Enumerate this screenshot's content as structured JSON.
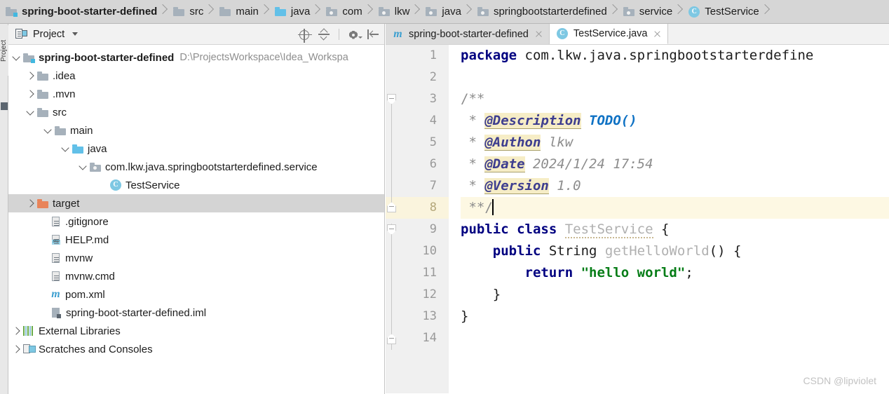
{
  "breadcrumb": {
    "items": [
      {
        "label": "spring-boot-starter-defined",
        "icon": "module-folder-icon",
        "bold": true
      },
      {
        "label": "src",
        "icon": "folder-icon",
        "bold": false
      },
      {
        "label": "main",
        "icon": "folder-icon",
        "bold": false
      },
      {
        "label": "java",
        "icon": "source-folder-icon",
        "bold": false
      },
      {
        "label": "com",
        "icon": "package-icon",
        "bold": false
      },
      {
        "label": "lkw",
        "icon": "package-icon",
        "bold": false
      },
      {
        "label": "java",
        "icon": "package-icon",
        "bold": false
      },
      {
        "label": "springbootstarterdefined",
        "icon": "package-icon",
        "bold": false
      },
      {
        "label": "service",
        "icon": "package-icon",
        "bold": false
      },
      {
        "label": "TestService",
        "icon": "java-class-icon",
        "bold": false
      }
    ]
  },
  "tool_strip": {
    "label": "Project"
  },
  "project_panel": {
    "title": "Project",
    "tools": [
      {
        "name": "locate-in-tree-icon",
        "title": "Select Opened File"
      },
      {
        "name": "collapse-all-icon",
        "title": "Collapse All"
      },
      {
        "name": "settings-gear-icon",
        "title": "Options"
      },
      {
        "name": "hide-panel-icon",
        "title": "Hide"
      }
    ],
    "tree": [
      {
        "label": "spring-boot-starter-defined",
        "path": "D:\\ProjectsWorkspace\\Idea_Workspa",
        "indent": 0,
        "twisty": "down",
        "icon": "module-folder-icon",
        "bold": true,
        "selected": false
      },
      {
        "label": ".idea",
        "path": "",
        "indent": 1,
        "twisty": "right",
        "icon": "folder-icon",
        "bold": false,
        "selected": false
      },
      {
        "label": ".mvn",
        "path": "",
        "indent": 1,
        "twisty": "right",
        "icon": "folder-icon",
        "bold": false,
        "selected": false
      },
      {
        "label": "src",
        "path": "",
        "indent": 1,
        "twisty": "down",
        "icon": "folder-icon",
        "bold": false,
        "selected": false
      },
      {
        "label": "main",
        "path": "",
        "indent": 2,
        "twisty": "down",
        "icon": "folder-icon",
        "bold": false,
        "selected": false
      },
      {
        "label": "java",
        "path": "",
        "indent": 3,
        "twisty": "down",
        "icon": "source-folder-icon",
        "bold": false,
        "selected": false
      },
      {
        "label": "com.lkw.java.springbootstarterdefined.service",
        "path": "",
        "indent": 4,
        "twisty": "down",
        "icon": "package-icon",
        "bold": false,
        "selected": false
      },
      {
        "label": "TestService",
        "path": "",
        "indent": 6,
        "twisty": "none",
        "icon": "java-class-icon",
        "bold": false,
        "selected": false
      },
      {
        "label": "target",
        "path": "",
        "indent": 1,
        "twisty": "right",
        "icon": "excluded-folder-icon",
        "bold": false,
        "selected": true
      },
      {
        "label": ".gitignore",
        "path": "",
        "indent": 2,
        "twisty": "none",
        "icon": "text-file-icon",
        "bold": false,
        "selected": false
      },
      {
        "label": "HELP.md",
        "path": "",
        "indent": 2,
        "twisty": "none",
        "icon": "markdown-file-icon",
        "bold": false,
        "selected": false
      },
      {
        "label": "mvnw",
        "path": "",
        "indent": 2,
        "twisty": "none",
        "icon": "text-file-icon",
        "bold": false,
        "selected": false
      },
      {
        "label": "mvnw.cmd",
        "path": "",
        "indent": 2,
        "twisty": "none",
        "icon": "text-file-icon",
        "bold": false,
        "selected": false
      },
      {
        "label": "pom.xml",
        "path": "",
        "indent": 2,
        "twisty": "none",
        "icon": "maven-file-icon",
        "bold": false,
        "selected": false
      },
      {
        "label": "spring-boot-starter-defined.iml",
        "path": "",
        "indent": 2,
        "twisty": "none",
        "icon": "iml-file-icon",
        "bold": false,
        "selected": false
      },
      {
        "label": "External Libraries",
        "path": "",
        "indent": 0,
        "twisty": "right",
        "icon": "libraries-icon",
        "bold": false,
        "selected": false
      },
      {
        "label": "Scratches and Consoles",
        "path": "",
        "indent": 0,
        "twisty": "right",
        "icon": "scratches-icon",
        "bold": false,
        "selected": false
      }
    ]
  },
  "editor": {
    "tabs": [
      {
        "label": "spring-boot-starter-defined",
        "icon": "maven-file-icon",
        "active": false
      },
      {
        "label": "TestService.java",
        "icon": "java-class-icon",
        "active": true
      }
    ],
    "lines": [
      {
        "no": "1",
        "caret_line": false
      },
      {
        "no": "2",
        "caret_line": false
      },
      {
        "no": "3",
        "caret_line": false
      },
      {
        "no": "4",
        "caret_line": false
      },
      {
        "no": "5",
        "caret_line": false
      },
      {
        "no": "6",
        "caret_line": false
      },
      {
        "no": "7",
        "caret_line": false
      },
      {
        "no": "8",
        "caret_line": true
      },
      {
        "no": "9",
        "caret_line": false
      },
      {
        "no": "10",
        "caret_line": false
      },
      {
        "no": "11",
        "caret_line": false
      },
      {
        "no": "12",
        "caret_line": false
      },
      {
        "no": "13",
        "caret_line": false
      },
      {
        "no": "14",
        "caret_line": false
      }
    ],
    "code": {
      "l1_kw": "package",
      "l1_pkg": " com.lkw.java.springbootstarterdefine",
      "l3": "/**",
      "l4_star": " * ",
      "l4_tag": "@Description",
      "l4_val": " TODO()",
      "l5_star": " * ",
      "l5_tag": "@Authon",
      "l5_val": " lkw",
      "l6_star": " * ",
      "l6_tag": "@Date",
      "l6_val": " 2024/1/24 17:54",
      "l7_star": " * ",
      "l7_tag": "@Version",
      "l7_val": " 1.0",
      "l8": " **/",
      "l9_kw": "public class",
      "l9_name": "TestService",
      "l9_brace": " {",
      "l10_kw": "public",
      "l10_type": " String ",
      "l10_name": "getHelloWorld",
      "l10_rest": "() {",
      "l11_kw": "return",
      "l11_str": " \"hello world\"",
      "l11_semi": ";",
      "l12": "    }",
      "l13": "}"
    }
  },
  "watermark": {
    "text": "CSDN @lipviolet"
  },
  "colors": {
    "breadcrumb_bg": "#d6d6d6",
    "panel_bg": "#f2f2f2",
    "selection": "#d4d4d4",
    "caret_line": "#fdf8e3",
    "keyword": "#000080",
    "string": "#067d17",
    "javadoc_tag_bg": "#f6edc6",
    "accent_blue": "#62c0e8",
    "excluded_orange": "#e8845a"
  }
}
